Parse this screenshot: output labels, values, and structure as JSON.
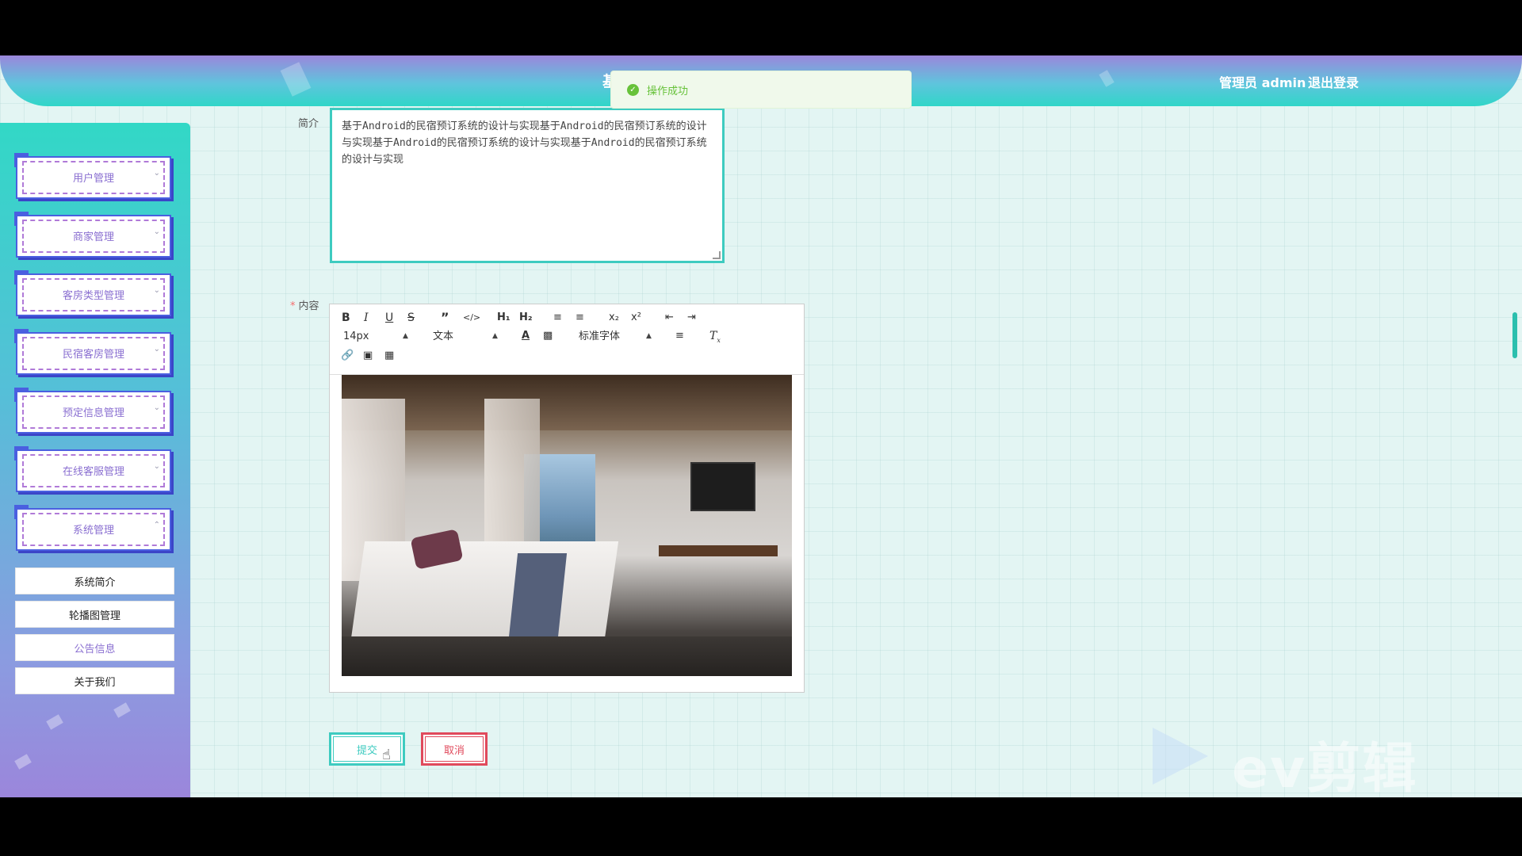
{
  "header": {
    "title_fragment": "基",
    "user_label": "管理员 admin",
    "logout_label": "退出登录"
  },
  "toast": {
    "message": "操作成功"
  },
  "sidebar": {
    "menus": [
      {
        "label": "用户管理"
      },
      {
        "label": "商家管理"
      },
      {
        "label": "客房类型管理"
      },
      {
        "label": "民宿客房管理"
      },
      {
        "label": "预定信息管理"
      },
      {
        "label": "在线客服管理"
      },
      {
        "label": "系统管理"
      }
    ],
    "submenu": [
      {
        "label": "系统简介"
      },
      {
        "label": "轮播图管理"
      },
      {
        "label": "公告信息"
      },
      {
        "label": "关于我们"
      }
    ]
  },
  "form": {
    "intro_label": "简介",
    "intro_value": "基于Android的民宿预订系统的设计与实现基于Android的民宿预订系统的设计与实现基于Android的民宿预订系统的设计与实现基于Android的民宿预订系统的设计与实现",
    "content_label": "内容",
    "submit_label": "提交",
    "cancel_label": "取消"
  },
  "editor": {
    "font_size": "14px",
    "header_select": "文本",
    "font_family": "标准字体",
    "icons": [
      "bold-icon",
      "italic-icon",
      "underline-icon",
      "strikethrough-icon",
      "blockquote-icon",
      "code-block-icon",
      "h1-icon",
      "h2-icon",
      "ordered-list-icon",
      "bullet-list-icon",
      "subscript-icon",
      "superscript-icon",
      "outdent-icon",
      "indent-icon",
      "font-color-icon",
      "background-color-icon",
      "align-icon",
      "clear-format-icon",
      "link-icon",
      "image-icon",
      "video-icon"
    ]
  },
  "watermark": {
    "text": "ev剪辑"
  },
  "colors": {
    "accent": "#3ecbc0",
    "danger": "#e04a5c",
    "success": "#67c23a",
    "menu_text": "#8a6fd1"
  }
}
